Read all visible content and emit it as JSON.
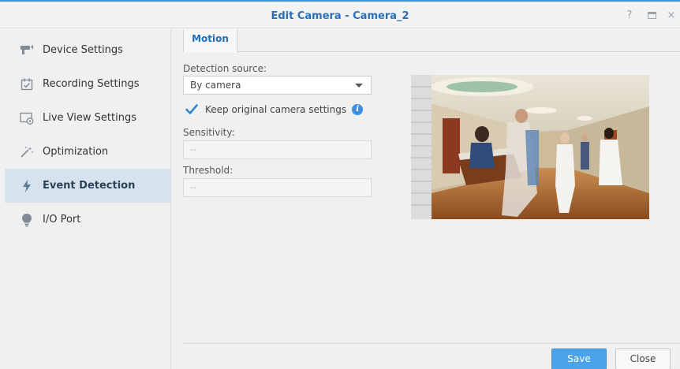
{
  "window": {
    "title": "Edit Camera - Camera_2",
    "controls": {
      "help": "?",
      "maximize": "maximize-icon",
      "close": "×"
    },
    "accent_color": "#3b8fd6"
  },
  "sidebar": {
    "items": [
      {
        "label": "Device Settings",
        "icon": "camera-icon",
        "active": false
      },
      {
        "label": "Recording Settings",
        "icon": "calendar-check-icon",
        "active": false
      },
      {
        "label": "Live View Settings",
        "icon": "live-view-icon",
        "active": false
      },
      {
        "label": "Optimization",
        "icon": "magic-wand-icon",
        "active": false
      },
      {
        "label": "Event Detection",
        "icon": "lightning-icon",
        "active": true
      },
      {
        "label": "I/O Port",
        "icon": "bulb-icon",
        "active": false
      }
    ]
  },
  "main": {
    "tabs": [
      {
        "label": "Motion",
        "active": true
      }
    ],
    "detection_source": {
      "label": "Detection source:",
      "value": "By camera"
    },
    "keep_original": {
      "label": "Keep original camera settings",
      "checked": true
    },
    "sensitivity": {
      "label": "Sensitivity:",
      "placeholder": "--"
    },
    "threshold": {
      "label": "Threshold:",
      "placeholder": "--"
    },
    "preview": {
      "alt": "camera preview"
    }
  },
  "footer": {
    "save_label": "Save",
    "close_label": "Close"
  }
}
